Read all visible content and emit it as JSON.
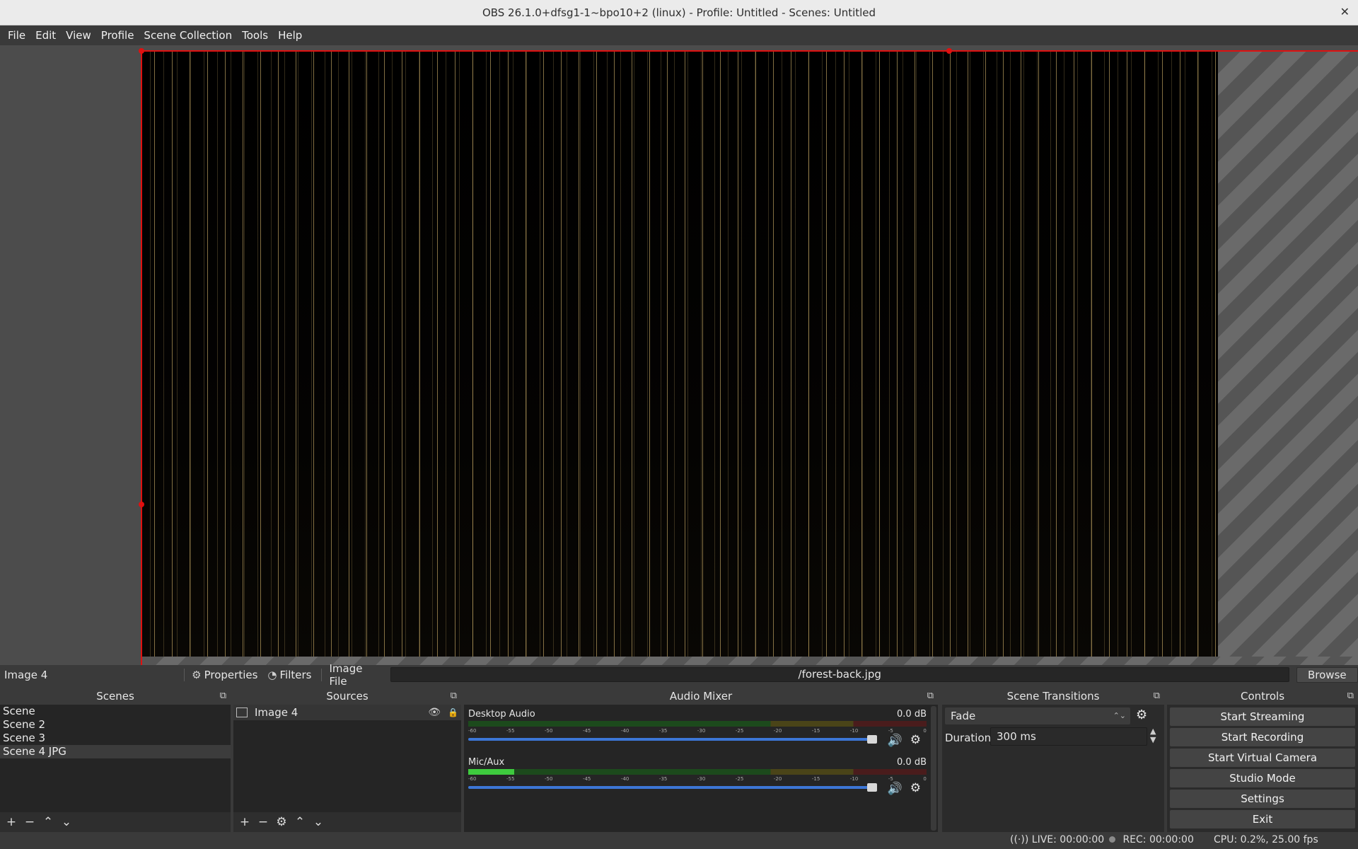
{
  "window": {
    "title": "OBS 26.1.0+dfsg1-1~bpo10+2 (linux) - Profile: Untitled - Scenes: Untitled",
    "close_icon": "close-icon"
  },
  "menu": [
    "File",
    "Edit",
    "View",
    "Profile",
    "Scene Collection",
    "Tools",
    "Help"
  ],
  "context_bar": {
    "selected_source": "Image 4",
    "properties_label": "Properties",
    "filters_label": "Filters",
    "image_file_label": "Image File",
    "image_path": "/forest-back.jpg",
    "browse_label": "Browse"
  },
  "scenes": {
    "title": "Scenes",
    "items": [
      "Scene",
      "Scene 2",
      "Scene 3",
      "Scene 4 JPG"
    ],
    "selected_index": 3
  },
  "sources": {
    "title": "Sources",
    "items": [
      "Image 4"
    ]
  },
  "audio_mixer": {
    "title": "Audio Mixer",
    "channels": [
      {
        "name": "Desktop Audio",
        "db": "0.0 dB",
        "meter_level": 0.0,
        "volume": 1.0
      },
      {
        "name": "Mic/Aux",
        "db": "0.0 dB",
        "meter_level": 0.1,
        "volume": 1.0
      }
    ],
    "tick_labels": [
      "-60",
      "-55",
      "-50",
      "-45",
      "-40",
      "-35",
      "-30",
      "-25",
      "-20",
      "-15",
      "-10",
      "-5",
      "0"
    ]
  },
  "scene_transitions": {
    "title": "Scene Transitions",
    "transition": "Fade",
    "duration_label": "Duration",
    "duration_value": "300 ms"
  },
  "controls": {
    "title": "Controls",
    "buttons": [
      "Start Streaming",
      "Start Recording",
      "Start Virtual Camera",
      "Studio Mode",
      "Settings",
      "Exit"
    ]
  },
  "status": {
    "live": "LIVE: 00:00:00",
    "rec": "REC: 00:00:00",
    "cpu": "CPU: 0.2%, 25.00 fps"
  },
  "colors": {
    "selection_border": "#e01010",
    "volume_slider": "#3c76d6",
    "meter_green": "#3ecb3e"
  }
}
